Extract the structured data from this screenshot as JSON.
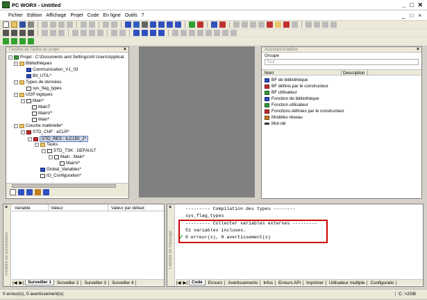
{
  "window": {
    "title": "PC WORX - Untitled",
    "min_glyph": "_",
    "max_glyph": "□",
    "close_glyph": "✕"
  },
  "menu": {
    "items": [
      "Fichier",
      "Edition",
      "Affichage",
      "Projet",
      "Code",
      "En ligne",
      "Outils",
      "?"
    ],
    "right": [
      "_",
      "□",
      "×"
    ]
  },
  "project_tree": {
    "header": "Fenêtre de l'arbre du projet",
    "close": "×",
    "items": [
      "Projet : C:\\Documents and Settings\\All Users\\Applicat",
      "Bibliothèques",
      "Communication_V1_03",
      "Bit_UTIL*",
      "Types de données",
      "sys_flag_types",
      "UOP logiques",
      "Main*",
      "MainT",
      "MainV*",
      "Main*",
      "Couche matérielle*",
      "STD_CNF : eCLR*",
      "STD_RES : ILC150_2*",
      "Tasks",
      "STD_TSK : DEFAULT",
      "Main : Main*",
      "MainV*",
      "Global_Variables*",
      "IO_Configuration*"
    ]
  },
  "edit_assistant": {
    "header": "Assistant d'édition",
    "close": "×",
    "group_label": "Groupe",
    "group_value": "Tout",
    "col_name": "Nom",
    "col_desc": "Description",
    "items": [
      "BF de bibliothèque",
      "BF définis par le constructeur",
      "BF utilisateur",
      "Fonction de bibliothèque",
      "Fonction utilisateur",
      "Fonctions définies par le constructeur",
      "Modèles réseau",
      "Mot-clé"
    ]
  },
  "watch": {
    "side_label": "Fenêtre de surveillance",
    "col_variable": "Variable",
    "col_value": "Valeur",
    "col_default": "Valeur par défaut",
    "tabs": [
      "Surveiller 1",
      "Surveiller 2",
      "Surveiller 3",
      "Surveiller 4"
    ]
  },
  "messages": {
    "side_label": "Fenêtre de message",
    "lines": [
      "--------- Compilation des types --------",
      "sys_flag_types",
      "--------- Collecter variables externes ---------",
      "51 variables incluses.",
      "0 erreur(s), 0 avertissement(s)"
    ],
    "tabs": [
      "Code",
      "Erreurs",
      "Avertissements",
      "Infos",
      "Erreurs API",
      "Imprimer",
      "Utilisateur multiple",
      "Configuratio"
    ]
  },
  "status": {
    "left": "0 erreur(s), 0 avertissement(s)",
    "right": "C: >2GB"
  },
  "colors": {
    "highlight_box": "#cc0000",
    "check": "#2a9a2a",
    "editor_bg": "#808080"
  }
}
